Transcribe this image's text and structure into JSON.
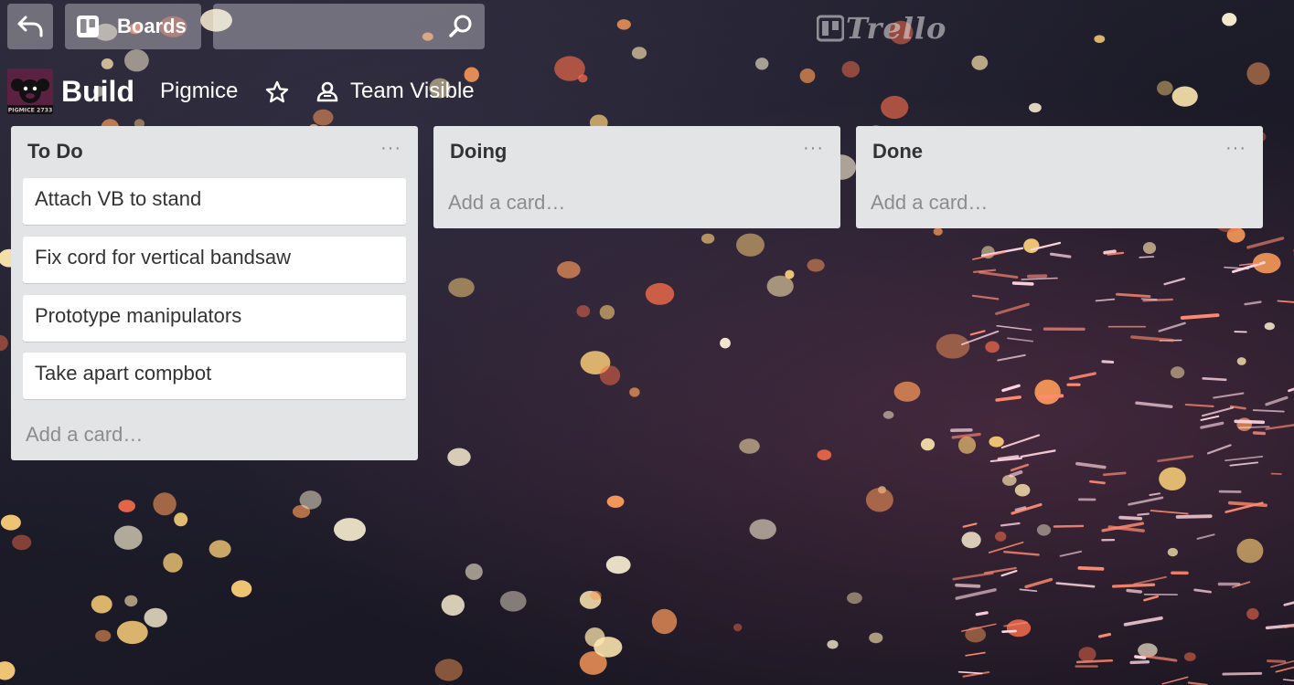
{
  "header": {
    "back_icon": "back-arrow-icon",
    "boards_icon": "boards-icon",
    "boards_label": "Boards",
    "search_value": "",
    "search_icon": "search-icon",
    "logo_text": "Trello"
  },
  "board": {
    "team_avatar_text": "PIGMICE 2733",
    "title": "Build",
    "team_name": "Pigmice",
    "star_icon": "star-icon",
    "visibility_icon": "team-icon",
    "visibility_label": "Team Visible"
  },
  "lists": [
    {
      "title": "To Do",
      "menu": "···",
      "cards": [
        "Attach VB to stand",
        "Fix cord for vertical bandsaw",
        "Prototype manipulators",
        "Take apart compbot"
      ],
      "add_card": "Add a card…"
    },
    {
      "title": "Doing",
      "menu": "···",
      "cards": [],
      "add_card": "Add a card…"
    },
    {
      "title": "Done",
      "menu": "···",
      "cards": [],
      "add_card": "Add a card…"
    }
  ],
  "colors": {
    "header_button_bg": "rgba(255,255,255,0.32)",
    "list_bg": "#e2e4e6",
    "card_bg": "#ffffff",
    "avatar_bg": "#5b2140"
  }
}
